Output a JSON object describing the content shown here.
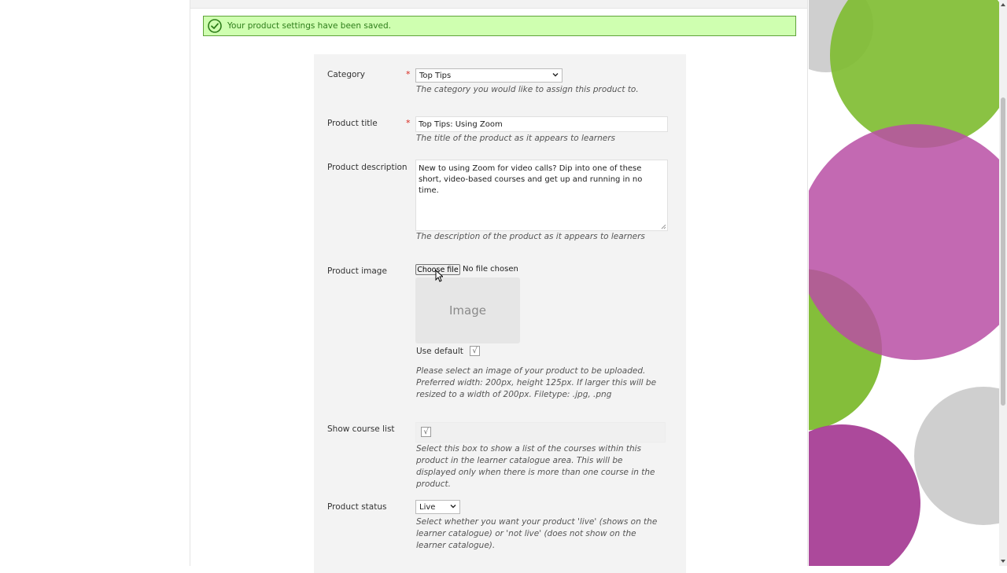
{
  "notice": {
    "text": "Your product settings have been saved."
  },
  "form": {
    "category": {
      "label": "Category",
      "required_mark": "*",
      "selected": "Top Tips",
      "help": "The category you would like to assign this product to."
    },
    "title": {
      "label": "Product title",
      "required_mark": "*",
      "value": "Top Tips: Using Zoom",
      "help": "The title of the product as it appears to learners"
    },
    "description": {
      "label": "Product description",
      "value": "New to using Zoom for video calls? Dip into one of these short, video-based courses and get up and running in no time.",
      "help": "The description of the product as it appears to learners"
    },
    "image": {
      "label": "Product image",
      "choose_button": "Choose file",
      "file_status": "No file chosen",
      "placeholder": "Image",
      "use_default_label": "Use default",
      "use_default_checked": "√",
      "help": "Please select an image of your product to be uploaded. Preferred width: 200px, height 125px. If larger this will be resized to a width of 200px. Filetype: .jpg, .png"
    },
    "course_list": {
      "label": "Show course list",
      "checked": "√",
      "help": "Select this box to show a list of the courses within this product in the learner catalogue area. This will be displayed only when there is more than one course in the product."
    },
    "status": {
      "label": "Product status",
      "selected": "Live",
      "help": "Select whether you want your product 'live' (shows on the learner catalogue) or 'not live' (does not show on the learner catalogue)."
    }
  },
  "colors": {
    "success_bg": "#cfffb0",
    "success_border": "#5fa33a",
    "required": "#d9261c",
    "deco_green": "#7dbb2f",
    "deco_magenta": "#b84fa4",
    "deco_gray": "#cccccc"
  }
}
